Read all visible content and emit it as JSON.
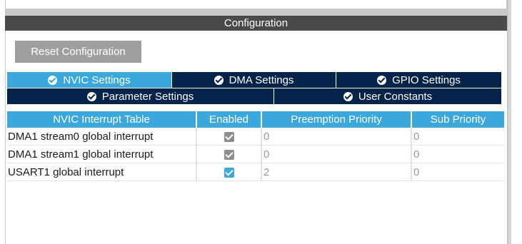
{
  "panel": {
    "title": "Configuration"
  },
  "toolbar": {
    "reset_label": "Reset Configuration"
  },
  "tabs": [
    {
      "label": "NVIC Settings",
      "active": true
    },
    {
      "label": "DMA Settings",
      "active": false
    },
    {
      "label": "GPIO Settings",
      "active": false
    },
    {
      "label": "Parameter Settings",
      "active": false
    },
    {
      "label": "User Constants",
      "active": false
    }
  ],
  "table": {
    "columns": [
      "NVIC Interrupt Table",
      "Enabled",
      "Preemption Priority",
      "Sub Priority"
    ],
    "rows": [
      {
        "name": "DMA1 stream0 global interrupt",
        "enabled": true,
        "enabled_locked": true,
        "preemption": "0",
        "sub": "0"
      },
      {
        "name": "DMA1 stream1 global interrupt",
        "enabled": true,
        "enabled_locked": true,
        "preemption": "0",
        "sub": "0"
      },
      {
        "name": "USART1 global interrupt",
        "enabled": true,
        "enabled_locked": false,
        "preemption": "2",
        "sub": "0"
      }
    ]
  },
  "colors": {
    "accent": "#3aa8dc",
    "tab_dark": "#03234b",
    "header_gray": "#4a4a4a",
    "button_gray": "#9e9fa1"
  },
  "icons": {
    "tab_status": "check-circle-icon",
    "checkbox": "checkbox-icon"
  }
}
